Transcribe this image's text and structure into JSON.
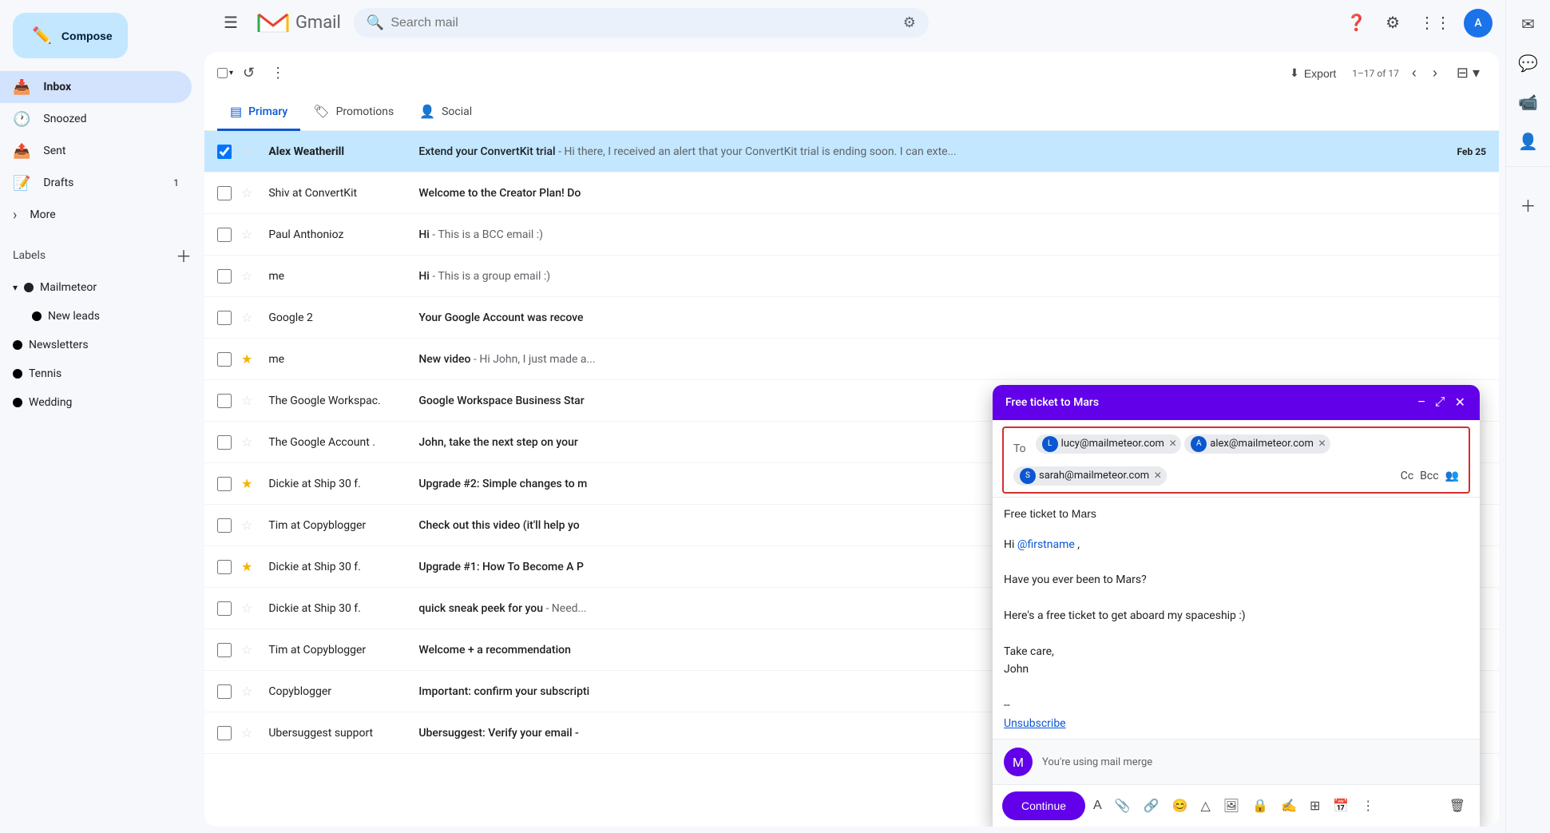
{
  "app": {
    "name": "Gmail",
    "logo_text": "Gmail"
  },
  "search": {
    "placeholder": "Search mail",
    "value": ""
  },
  "top_icons": [
    "help",
    "settings",
    "apps",
    "avatar"
  ],
  "avatar_letter": "A",
  "compose_btn": "Compose",
  "sidebar": {
    "nav_items": [
      {
        "id": "inbox",
        "label": "Inbox",
        "icon": "📥",
        "active": true,
        "badge": ""
      },
      {
        "id": "snoozed",
        "label": "Snoozed",
        "icon": "🕐",
        "active": false,
        "badge": ""
      },
      {
        "id": "sent",
        "label": "Sent",
        "icon": "📤",
        "active": false,
        "badge": ""
      },
      {
        "id": "drafts",
        "label": "Drafts",
        "icon": "📝",
        "active": false,
        "badge": "1"
      },
      {
        "id": "more",
        "label": "More",
        "icon": "▾",
        "active": false,
        "badge": ""
      }
    ],
    "labels_header": "Labels",
    "labels": [
      {
        "id": "mailmeteor",
        "label": "Mailmeteor",
        "dot_color": "#202124",
        "expanded": true
      },
      {
        "id": "new-leads",
        "label": "New leads",
        "dot_color": "#000",
        "indent": true
      },
      {
        "id": "newsletters",
        "label": "Newsletters",
        "dot_color": "#000"
      },
      {
        "id": "tennis",
        "label": "Tennis",
        "dot_color": "#000"
      },
      {
        "id": "wedding",
        "label": "Wedding",
        "dot_color": "#000"
      }
    ]
  },
  "toolbar": {
    "select_all_label": "",
    "refresh_label": "",
    "more_label": "",
    "export_label": "Export",
    "export_icon": "⬇",
    "pagination": "1–17 of 17"
  },
  "tabs": [
    {
      "id": "primary",
      "label": "Primary",
      "icon": "▤",
      "active": true
    },
    {
      "id": "promotions",
      "label": "Promotions",
      "icon": "🏷",
      "active": false
    },
    {
      "id": "social",
      "label": "Social",
      "icon": "👤",
      "active": false
    }
  ],
  "emails": [
    {
      "id": 1,
      "selected": true,
      "starred": false,
      "sender": "Alex Weatherill",
      "subject": "Extend your ConvertKit trial",
      "snippet": "Hi there, I received an alert that your ConvertKit trial is ending soon. I can exte...",
      "date": "Feb 25",
      "unread": true,
      "reply": false
    },
    {
      "id": 2,
      "selected": false,
      "starred": false,
      "sender": "Shiv at ConvertKit",
      "subject": "Welcome to the Creator Plan! Do",
      "snippet": "",
      "date": "",
      "unread": false,
      "reply": false
    },
    {
      "id": 3,
      "selected": false,
      "starred": false,
      "sender": "Paul Anthonioz",
      "subject": "Hi",
      "snippet": "This is a BCC email :)",
      "date": "",
      "unread": false,
      "reply": false
    },
    {
      "id": 4,
      "selected": false,
      "starred": false,
      "sender": "me",
      "subject": "Hi",
      "snippet": "This is a group email :)",
      "date": "",
      "unread": false,
      "reply": false
    },
    {
      "id": 5,
      "selected": false,
      "starred": false,
      "sender": "Google 2",
      "subject": "Your Google Account was recove",
      "snippet": "",
      "date": "",
      "unread": false,
      "reply": false
    },
    {
      "id": 6,
      "selected": false,
      "starred": true,
      "sender": "me",
      "subject": "New video",
      "snippet": "Hi John, I just made a...",
      "date": "",
      "unread": false,
      "reply": false
    },
    {
      "id": 7,
      "selected": false,
      "starred": false,
      "sender": "The Google Workspac.",
      "subject": "Google Workspace Business Star",
      "snippet": "",
      "date": "",
      "unread": false,
      "reply": false
    },
    {
      "id": 8,
      "selected": false,
      "starred": false,
      "sender": "The Google Account .",
      "subject": "John, take the next step on your",
      "snippet": "",
      "date": "",
      "unread": false,
      "reply": false
    },
    {
      "id": 9,
      "selected": false,
      "starred": true,
      "sender": "Dickie at Ship 30 f.",
      "subject": "Upgrade #2: Simple changes to m",
      "snippet": "",
      "date": "",
      "unread": false,
      "reply": false
    },
    {
      "id": 10,
      "selected": false,
      "starred": false,
      "sender": "Tim at Copyblogger",
      "subject": "Check out this video (it'll help yo",
      "snippet": "",
      "date": "",
      "unread": false,
      "reply": false
    },
    {
      "id": 11,
      "selected": false,
      "starred": true,
      "sender": "Dickie at Ship 30 f.",
      "subject": "Upgrade #1: How To Become A P",
      "snippet": "",
      "date": "",
      "unread": false,
      "reply": false
    },
    {
      "id": 12,
      "selected": false,
      "starred": false,
      "sender": "Dickie at Ship 30 f.",
      "subject": "quick sneak peek for you",
      "snippet": "Need...",
      "date": "",
      "unread": false,
      "reply": false
    },
    {
      "id": 13,
      "selected": false,
      "starred": false,
      "sender": "Tim at Copyblogger",
      "subject": "Welcome + a recommendation",
      "snippet": "",
      "date": "",
      "unread": false,
      "reply": false
    },
    {
      "id": 14,
      "selected": false,
      "starred": false,
      "sender": "Copyblogger",
      "subject": "Important: confirm your subscripti",
      "snippet": "",
      "date": "",
      "unread": false,
      "reply": false
    },
    {
      "id": 15,
      "selected": false,
      "starred": false,
      "sender": "Ubersuggest support",
      "subject": "Ubersuggest: Verify your email -",
      "snippet": "",
      "date": "",
      "unread": false,
      "reply": false
    }
  ],
  "compose": {
    "title": "Free ticket to Mars",
    "to_label": "To",
    "recipients": [
      {
        "email": "lucy@mailmeteor.com",
        "avatar": "L"
      },
      {
        "email": "alex@mailmeteor.com",
        "avatar": "A"
      },
      {
        "email": "sarah@mailmeteor.com",
        "avatar": "S"
      }
    ],
    "cc_label": "Cc",
    "bcc_label": "Bcc",
    "subject": "Free ticket to Mars",
    "body_lines": [
      "Hi @firstname ,",
      "",
      "Have you ever been to Mars?",
      "",
      "Here's a free ticket to get aboard my spaceship :)",
      "",
      "Take care,",
      "John",
      "",
      "--",
      "Unsubscribe"
    ],
    "mail_merge_text": "You're using mail merge",
    "continue_btn": "Continue",
    "toolbar_icons": [
      "bold",
      "attach",
      "link",
      "emoji",
      "drive",
      "photo",
      "lock",
      "signature",
      "table",
      "calendar",
      "more"
    ]
  }
}
